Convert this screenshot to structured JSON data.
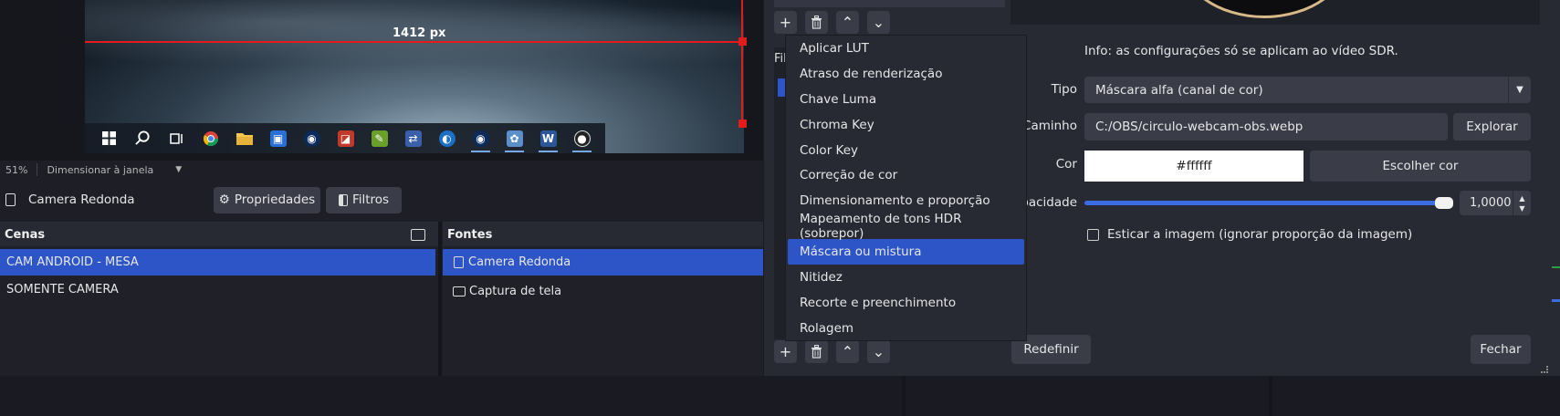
{
  "preview": {
    "measure_label": "1412 px"
  },
  "status_bar": {
    "zoom": "51%",
    "scale_mode": "Dimensionar à janela"
  },
  "source_toolbar": {
    "source_name": "Camera Redonda",
    "properties_label": "Propriedades",
    "filters_label": "Filtros"
  },
  "scenes": {
    "title": "Cenas",
    "items": [
      "CAM ANDROID - MESA",
      "SOMENTE CAMERA"
    ],
    "selected_index": 0
  },
  "sources": {
    "title": "Fontes",
    "items": [
      "Camera Redonda",
      "Captura de tela"
    ],
    "selected_index": 0
  },
  "filters_window": {
    "list_label": "Fil",
    "info": "Info: as configurações só se aplicam ao vídeo SDR.",
    "type_label": "Tipo",
    "type_value": "Máscara alfa (canal de cor)",
    "path_label": "Caminho",
    "path_value": "C:/OBS/circulo-webcam-obs.webp",
    "browse_label": "Explorar",
    "color_label": "Cor",
    "color_value": "#ffffff",
    "choose_color_label": "Escolher cor",
    "opacity_label": "pacidade",
    "opacity_value": "1,0000",
    "opacity_fraction": 1.0,
    "stretch_label": "Esticar a imagem (ignorar proporção da imagem)",
    "reset_label": "Redefinir",
    "close_label": "Fechar"
  },
  "add_filter_menu": {
    "items": [
      "Aplicar LUT",
      "Atraso de renderização",
      "Chave Luma",
      "Chroma Key",
      "Color Key",
      "Correção de cor",
      "Dimensionamento e proporção",
      "Mapeamento de tons HDR (sobrepor)",
      "Máscara ou mistura",
      "Nitidez",
      "Recorte e preenchimento",
      "Rolagem"
    ],
    "selected_index": 8
  },
  "colors": {
    "accent": "#2d55c8",
    "guide": "#e21b1b",
    "slider": "#3d6be0"
  },
  "icons": {
    "add": "plus-icon",
    "remove": "trash-icon",
    "up": "chevron-up-icon",
    "down": "chevron-down-icon",
    "properties": "gear-icon",
    "filters": "filter-icon"
  }
}
